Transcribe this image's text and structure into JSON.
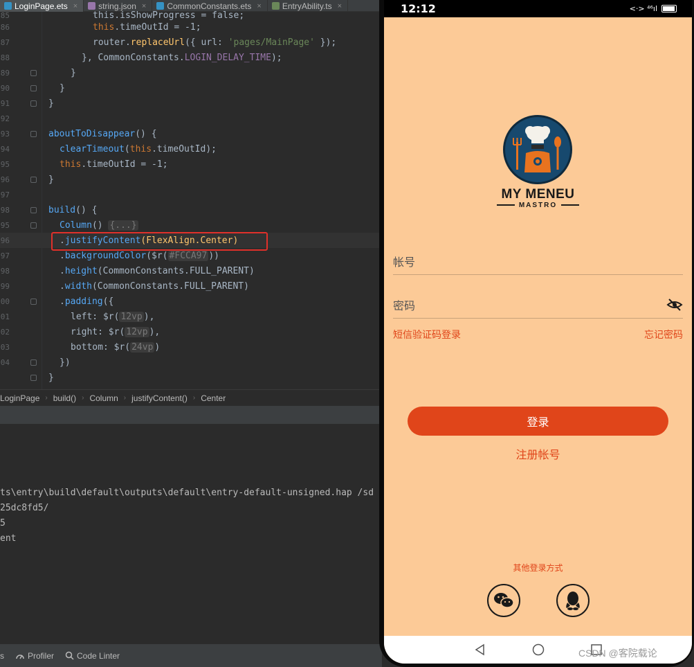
{
  "ide": {
    "tabs": [
      {
        "label": "LoginPage.ets",
        "active": true
      },
      {
        "label": "string.json"
      },
      {
        "label": "CommonConstants.ets"
      },
      {
        "label": "EntryAbility.ts"
      }
    ],
    "line_numbers": [
      "85",
      "86",
      "87",
      "88",
      "89",
      "90",
      "91",
      "92",
      "93",
      "94",
      "95",
      "96",
      "97",
      "98",
      "95",
      "96",
      "97",
      "98",
      "99",
      "00",
      "01",
      "02",
      "03",
      "04"
    ],
    "code": {
      "l1": "this.isShowProgress = false;",
      "l2a": "this",
      "l2b": ".timeOutId = -1;",
      "l3a": "router.",
      "l3b": "replaceUrl",
      "l3c": "({ url: ",
      "l3d": "'pages/MainPage'",
      "l3e": " });",
      "l4a": "}, CommonConstants.",
      "l4b": "LOGIN_DELAY_TIME",
      "l4c": ");",
      "l5": "}",
      "l6": "}",
      "l7": "}",
      "l9a": "aboutToDisappear",
      "l9b": "() {",
      "l10a": "clearTimeout",
      "l10b": "(",
      "l10c": "this",
      "l10d": ".timeOutId);",
      "l11a": "this",
      "l11b": ".timeOutId = -1;",
      "l12": "}",
      "l14a": "build",
      "l14b": "() {",
      "l15a": "Column",
      "l15b": "() ",
      "l15c": "{...}",
      "l16a": ".",
      "l16b": "justifyContent",
      "l16c": "(FlexAlign.",
      "l16d": "Center",
      "l16e": ")",
      "l17a": ".",
      "l17b": "backgroundColor",
      "l17c": "($r(",
      "l17d": "#FCCA97",
      "l17e": "))",
      "l18a": ".",
      "l18b": "height",
      "l18c": "(CommonConstants.",
      "l18d": "FULL_PARENT",
      "l18e": ")",
      "l19a": ".",
      "l19b": "width",
      "l19c": "(CommonConstants.",
      "l19d": "FULL_PARENT",
      "l19e": ")",
      "l20a": ".",
      "l20b": "padding",
      "l20c": "({",
      "l21a": "left: ",
      "l21b": "$r(",
      "l21c": "12vp",
      "l21d": "),",
      "l22a": "right: ",
      "l22b": "$r(",
      "l22c": "12vp",
      "l22d": "),",
      "l23a": "bottom: ",
      "l23b": "$r(",
      "l23c": "24vp",
      "l23d": ")",
      "l24": "})",
      "l25": "}"
    },
    "breadcrumb": [
      "LoginPage",
      "build()",
      "Column",
      "justifyContent()",
      "Center"
    ],
    "console": [
      "ts\\entry\\build\\default\\outputs\\default\\entry-default-unsigned.hap /sd",
      "25dc8fd5/",
      "5",
      "ent"
    ],
    "statusbar": [
      "s",
      "Profiler",
      "Code Linter"
    ]
  },
  "phone": {
    "time": "12:12",
    "signal": "<·> ⁴⁶ıl",
    "logo_title": "MY MENEU",
    "logo_subtitle": "MASTRO",
    "account_placeholder": "帐号",
    "password_placeholder": "密码",
    "sms_login": "短信验证码登录",
    "forgot_password": "忘记密码",
    "login_button": "登录",
    "register": "注册帐号",
    "other_login": "其他登录方式",
    "background_color": "#FCCA97",
    "accent_color": "#E0451A"
  },
  "watermark": "CSDN @客院载论"
}
